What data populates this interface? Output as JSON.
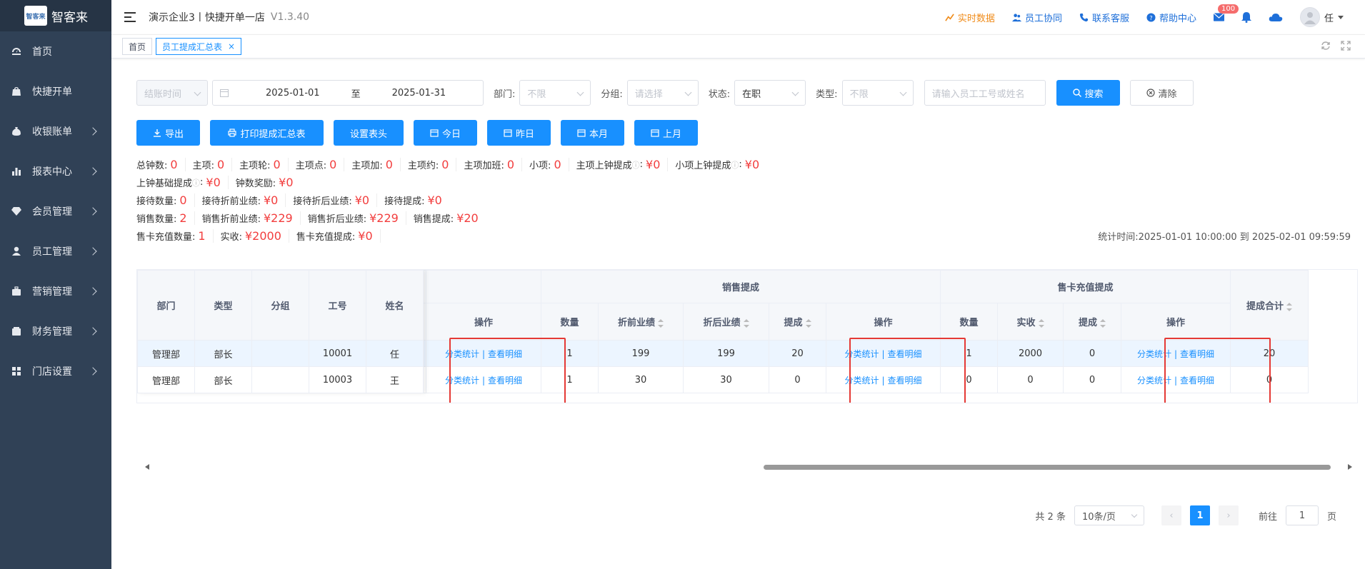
{
  "sidebar": {
    "logo_badge": "智客来",
    "logo_text": "智客来",
    "items": [
      {
        "label": "首页",
        "icon": "dashboard-icon",
        "arrow": false
      },
      {
        "label": "快捷开单",
        "icon": "bag-icon",
        "arrow": false
      },
      {
        "label": "收银账单",
        "icon": "money-bag-icon",
        "arrow": true
      },
      {
        "label": "报表中心",
        "icon": "bar-chart-icon",
        "arrow": true
      },
      {
        "label": "会员管理",
        "icon": "diamond-icon",
        "arrow": true
      },
      {
        "label": "员工管理",
        "icon": "user-icon",
        "arrow": true
      },
      {
        "label": "营销管理",
        "icon": "briefcase-icon",
        "arrow": true
      },
      {
        "label": "财务管理",
        "icon": "wallet-icon",
        "arrow": true
      },
      {
        "label": "门店设置",
        "icon": "grid-icon",
        "arrow": true
      }
    ]
  },
  "header": {
    "company": "演示企业3丨快捷开单一店",
    "version": "V1.3.40",
    "realtime": "实时数据",
    "collab": "员工协同",
    "support": "联系客服",
    "help": "帮助中心",
    "mail_badge": "100",
    "user_name": "任"
  },
  "tabs": [
    {
      "label": "首页"
    },
    {
      "label": "员工提成汇总表",
      "close": "×"
    }
  ],
  "filters": {
    "time_type": "结账时间",
    "date_start": "2025-01-01",
    "date_sep": "至",
    "date_end": "2025-01-31",
    "dept_label": "部门:",
    "dept_value": "不限",
    "group_label": "分组:",
    "group_value": "请选择",
    "status_label": "状态:",
    "status_value": "在职",
    "type_label": "类型:",
    "type_value": "不限",
    "search_placeholder": "请输入员工工号或姓名",
    "search_btn": "搜索",
    "clear_btn": "清除"
  },
  "actions": [
    "导出",
    "打印提成汇总表",
    "设置表头",
    "今日",
    "昨日",
    "本月",
    "上月"
  ],
  "stats": {
    "row1": [
      {
        "label": "总钟数:",
        "value": "0"
      },
      {
        "label": "主项:",
        "value": "0"
      },
      {
        "label": "主项轮:",
        "value": "0"
      },
      {
        "label": "主项点:",
        "value": "0"
      },
      {
        "label": "主项加:",
        "value": "0"
      },
      {
        "label": "主项约:",
        "value": "0"
      },
      {
        "label": "主项加班:",
        "value": "0"
      },
      {
        "label": "小项:",
        "value": "0"
      },
      {
        "label": "主项上钟提成",
        "info": "ⓘ",
        "colon": ":",
        "value": "¥0"
      },
      {
        "label": "小项上钟提成",
        "info": "ⓘ",
        "colon": ":",
        "value": "¥0"
      }
    ],
    "row2": [
      {
        "label": "上钟基础提成",
        "info": "ⓘ",
        "colon": ":",
        "value": "¥0"
      },
      {
        "label": "钟数奖励:",
        "value": "¥0"
      }
    ],
    "row3": [
      {
        "label": "接待数量:",
        "value": "0"
      },
      {
        "label": "接待折前业绩:",
        "value": "¥0"
      },
      {
        "label": "接待折后业绩:",
        "value": "¥0"
      },
      {
        "label": "接待提成:",
        "value": "¥0"
      }
    ],
    "row4": [
      {
        "label": "销售数量:",
        "value": "2"
      },
      {
        "label": "销售折前业绩:",
        "value": "¥229"
      },
      {
        "label": "销售折后业绩:",
        "value": "¥229"
      },
      {
        "label": "销售提成:",
        "value": "¥20"
      }
    ],
    "row5": [
      {
        "label": "售卡充值数量:",
        "value": "1"
      },
      {
        "label": "实收:",
        "value": "¥2000"
      },
      {
        "label": "售卡充值提成:",
        "value": "¥0"
      }
    ],
    "stat_time": "统计时间:2025-01-01 10:00:00 到 2025-02-01 09:59:59"
  },
  "table": {
    "fixed_headers": [
      "部门",
      "类型",
      "分组",
      "工号",
      "姓名"
    ],
    "group_sales": "销售提成",
    "group_card": "售卡充值提成",
    "op_header": "操作",
    "sales_headers": [
      "数量",
      "折前业绩",
      "折后业绩",
      "提成"
    ],
    "card_headers": [
      "数量",
      "实收",
      "提成"
    ],
    "total_header": "提成合计",
    "op_links": [
      "分类统计",
      "查看明细"
    ],
    "op_sep": "|",
    "rows": [
      {
        "dept": "管理部",
        "type": "部长",
        "group": "",
        "id": "10001",
        "name": "任",
        "sales": [
          "1",
          "199",
          "199",
          "20"
        ],
        "card": [
          "1",
          "2000",
          "0"
        ],
        "total": "20"
      },
      {
        "dept": "管理部",
        "type": "部长",
        "group": "",
        "id": "10003",
        "name": "王",
        "sales": [
          "1",
          "30",
          "30",
          "0"
        ],
        "card": [
          "0",
          "0",
          "0"
        ],
        "total": "0"
      }
    ]
  },
  "pagination": {
    "total": "共 2 条",
    "size": "10条/页",
    "prev": "‹",
    "page": "1",
    "next": "›",
    "goto": "前往",
    "goto_value": "1",
    "unit": "页"
  }
}
